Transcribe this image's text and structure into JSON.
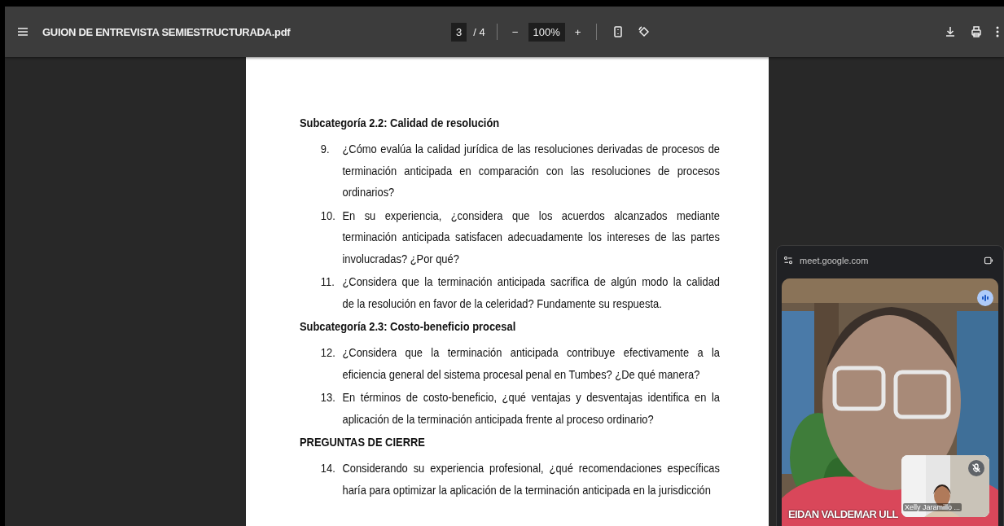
{
  "toolbar": {
    "title": "GUION DE ENTREVISTA SEMIESTRUCTURADA.pdf",
    "page_current": "3",
    "page_total": "/ 4",
    "zoom_out": "−",
    "zoom": "100%",
    "zoom_in": "+"
  },
  "document": {
    "blocks": [
      {
        "kind": "heading",
        "text": "Subcategoría 2.2: Calidad de resolución"
      },
      {
        "kind": "item",
        "number": "9.",
        "lines": [
          "¿Cómo evalúa la calidad jurídica de las resoluciones derivadas de procesos de",
          "terminación anticipada en comparación con las resoluciones de procesos",
          "ordinarios?"
        ]
      },
      {
        "kind": "item",
        "number": "10.",
        "lines": [
          "En su experiencia, ¿considera que los acuerdos alcanzados mediante",
          "terminación anticipada satisfacen adecuadamente los intereses de las partes",
          "involucradas? ¿Por qué?"
        ]
      },
      {
        "kind": "item",
        "number": "11.",
        "lines": [
          "¿Considera que la terminación anticipada sacrifica de algún modo la calidad",
          "de la resolución en favor de la celeridad? Fundamente su respuesta."
        ]
      },
      {
        "kind": "heading",
        "text": "Subcategoría 2.3: Costo-beneficio procesal"
      },
      {
        "kind": "item",
        "number": "12.",
        "lines": [
          "¿Considera que la terminación anticipada contribuye efectivamente a la",
          "eficiencia general del sistema procesal penal en Tumbes? ¿De qué manera?"
        ]
      },
      {
        "kind": "item",
        "number": "13.",
        "lines": [
          "En términos de costo-beneficio, ¿qué ventajas y desventajas identifica en la",
          "aplicación de la terminación anticipada frente al proceso ordinario?"
        ]
      },
      {
        "kind": "heading",
        "text": "PREGUNTAS DE CIERRE"
      },
      {
        "kind": "item",
        "number": "14.",
        "lines": [
          "Considerando su experiencia profesional, ¿qué recomendaciones específicas",
          "haría para optimizar la aplicación de la terminación anticipada en la jurisdicción"
        ]
      }
    ]
  },
  "meet": {
    "url": "meet.google.com",
    "main_name": "EIDAN VALDEMAR ULL",
    "speaking": true,
    "self_name": "Xelly Jaramillo ...",
    "self_muted": true
  }
}
